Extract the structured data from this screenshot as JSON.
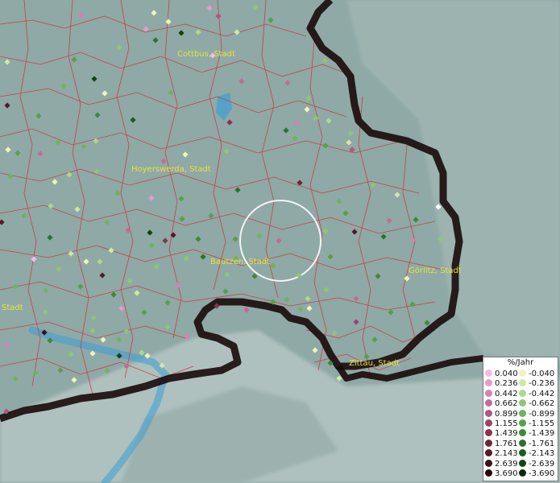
{
  "map": {
    "cities": [
      "Cottbus, Stadt",
      "Hoyerswerda, Stadt",
      "Bautzen, Stadt",
      "Görlitz, Stadt",
      "Zittau, Stadt",
      "Stadt"
    ],
    "colors": {
      "background": "#8fa9a6",
      "district_lines": "#d2303a",
      "border": "#1a0a0a",
      "city_label": "#e8e23a",
      "water": "#3d9fd6"
    },
    "marker_style": "diamond"
  },
  "legend": {
    "title": "%/Jahr",
    "positive": [
      {
        "label": "0.040",
        "color": "#f2b9ea"
      },
      {
        "label": "0.236",
        "color": "#e59ccd"
      },
      {
        "label": "0.442",
        "color": "#d581b2"
      },
      {
        "label": "0.662",
        "color": "#c56a98"
      },
      {
        "label": "0.899",
        "color": "#b15680"
      },
      {
        "label": "1.155",
        "color": "#9c4467"
      },
      {
        "label": "1.439",
        "color": "#86344f"
      },
      {
        "label": "1.761",
        "color": "#6e253a"
      },
      {
        "label": "2.143",
        "color": "#571927"
      },
      {
        "label": "2.639",
        "color": "#3f0f18"
      },
      {
        "label": "3.690",
        "color": "#26060b"
      }
    ],
    "negative": [
      {
        "label": "-0.040",
        "color": "#eef5b9"
      },
      {
        "label": "-0.236",
        "color": "#cfe8a3"
      },
      {
        "label": "-0.442",
        "color": "#aed88c"
      },
      {
        "label": "-0.662",
        "color": "#8dc775"
      },
      {
        "label": "-0.899",
        "color": "#6fb35f"
      },
      {
        "label": "-1.155",
        "color": "#56a04b"
      },
      {
        "label": "-1.439",
        "color": "#3e8a3a"
      },
      {
        "label": "-1.761",
        "color": "#2d732b"
      },
      {
        "label": "-2.143",
        "color": "#1f5c1f"
      },
      {
        "label": "-2.639",
        "color": "#124413"
      },
      {
        "label": "-3.690",
        "color": "#062a07"
      }
    ]
  }
}
